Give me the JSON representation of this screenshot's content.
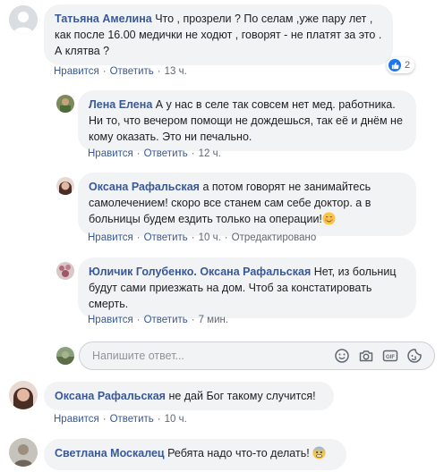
{
  "comments": [
    {
      "author": "Татьяна Амелина",
      "text": "Что , прозрели ? По селам ,уже пару лет , как после 16.00 медички не ходют , говорят - не платят за это . А клятва ?",
      "like": "Нравится",
      "reply": "Ответить",
      "time": "13 ч.",
      "reaction_count": "2"
    },
    {
      "author": "Лена Елена",
      "text": "А у нас в селе так совсем нет мед. работника. Ни то, что вечером помощи не дождешься, так её и днём не кому оказать. Это ни печально.",
      "like": "Нравится",
      "reply": "Ответить",
      "time": "12 ч."
    },
    {
      "author": "Оксана Рафальская",
      "text": "а потом говорят не занимайтесь самолечением! скоро все станем сам себе доктор. а в больницы будем ездить только на операции!",
      "like": "Нравится",
      "reply": "Ответить",
      "time": "10 ч.",
      "edited": "Отредактировано"
    },
    {
      "author": "Юличик Голубенко.",
      "mention": "Оксана Рафальская",
      "text": "Нет, из больниц будут сами приезжать на дом. Чтоб за констатировать смерть.",
      "like": "Нравится",
      "reply": "Ответить",
      "time": "7 мин."
    },
    {
      "author": "Оксана Рафальская",
      "text": "не дай Бог такому случится!",
      "like": "Нравится",
      "reply": "Ответить",
      "time": "10 ч."
    },
    {
      "author": "Светлана Москалец",
      "text": "Ребята надо что-то делать!"
    }
  ],
  "reply_input": {
    "placeholder": "Напишите ответ..."
  },
  "tools": [
    "emoji-icon",
    "camera-icon",
    "gif-icon",
    "sticker-icon"
  ],
  "colors": {
    "link": "#385898",
    "bubble": "#f2f3f5",
    "meta": "#616770",
    "like_blue": "#1877f2"
  }
}
